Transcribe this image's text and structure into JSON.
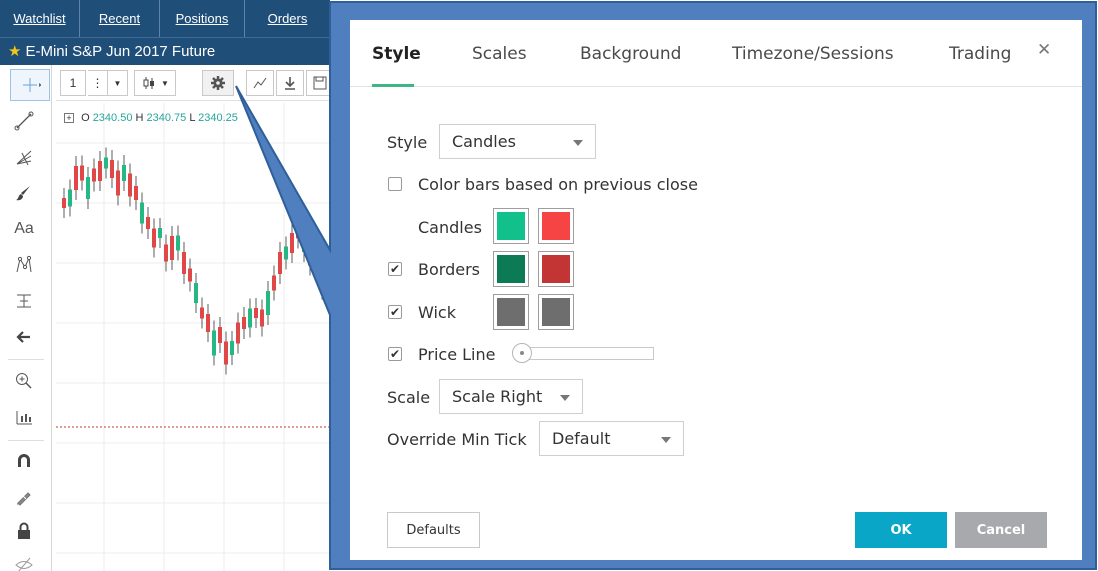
{
  "app": {
    "nav_tabs": [
      "Watchlist",
      "Recent",
      "Positions",
      "Orders"
    ],
    "instrument_title": "E-Mini S&P Jun 2017 Future",
    "toolbar": {
      "interval": "1"
    },
    "ohlc": {
      "open_label": "O",
      "open": "2340.50",
      "high_label": "H",
      "high": "2340.75",
      "low_label": "L",
      "low": "2340.25"
    },
    "left_tools": {
      "text_label": "Aa"
    }
  },
  "dialog": {
    "tabs": [
      "Style",
      "Scales",
      "Background",
      "Timezone/Sessions",
      "Trading"
    ],
    "active_tab": "Style",
    "style_label": "Style",
    "style_value": "Candles",
    "color_bars_label": "Color bars based on previous close",
    "color_bars_checked": false,
    "candles_label": "Candles",
    "borders_label": "Borders",
    "borders_checked": true,
    "wick_label": "Wick",
    "wick_checked": true,
    "price_line_label": "Price Line",
    "price_line_checked": true,
    "scale_label": "Scale",
    "scale_value": "Scale Right",
    "override_label": "Override Min Tick",
    "override_value": "Default",
    "defaults_button": "Defaults",
    "ok_button": "OK",
    "cancel_button": "Cancel",
    "colors": {
      "candles_up": "#11c08a",
      "candles_down": "#f64343",
      "borders_up": "#0d7a56",
      "borders_down": "#c33434",
      "wick_up": "#6e6e6e",
      "wick_down": "#6e6e6e",
      "callout_blue": "#4f7fbe"
    }
  }
}
